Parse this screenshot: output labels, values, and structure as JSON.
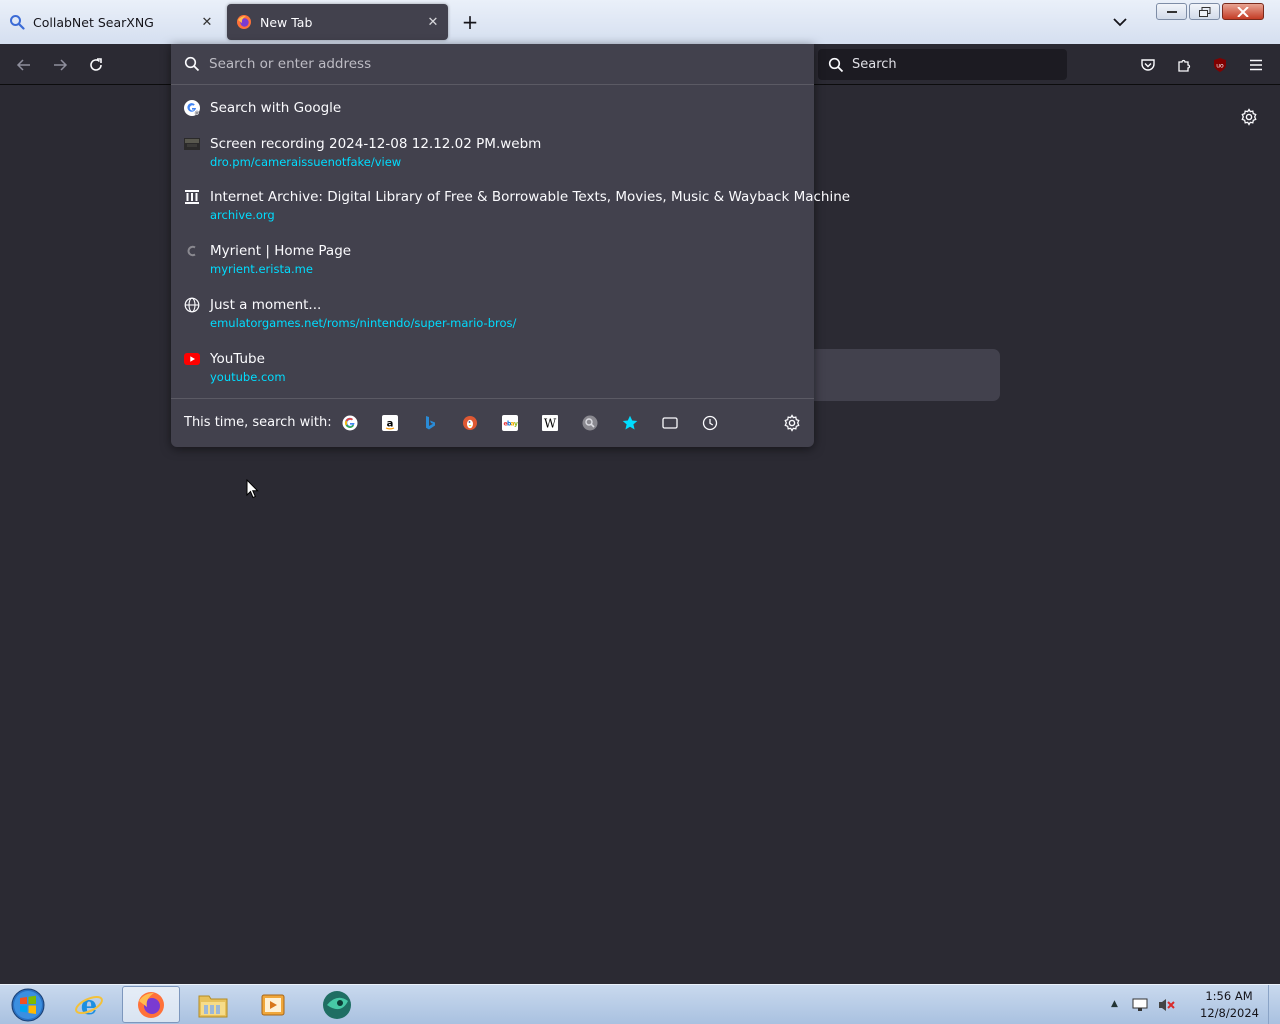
{
  "colors": {
    "accent_url": "#00ddff",
    "popup_bg": "#42414d",
    "page_bg": "#2b2a33"
  },
  "tabs": [
    {
      "title": "CollabNet SearXNG",
      "icon": "search-icon",
      "active": false
    },
    {
      "title": "New Tab",
      "icon": "firefox-icon",
      "active": true
    }
  ],
  "navbar": {
    "search_label": "Search"
  },
  "urlbar": {
    "placeholder": "Search or enter address",
    "value": ""
  },
  "results": [
    {
      "title": "Search with Google",
      "url": "",
      "icon": "google-search-icon"
    },
    {
      "title": "Screen recording 2024-12-08 12.12.02 PM.webm",
      "url": "dro.pm/cameraissuenotfake/view",
      "icon": "video-thumbnail-icon"
    },
    {
      "title": "Internet Archive: Digital Library of Free & Borrowable Texts, Movies, Music & Wayback Machine",
      "url": "archive.org",
      "icon": "archive-icon"
    },
    {
      "title": "Myrient | Home Page",
      "url": "myrient.erista.me",
      "icon": "myrient-icon"
    },
    {
      "title": "Just a moment...",
      "url": "emulatorgames.net/roms/nintendo/super-mario-bros/",
      "icon": "globe-icon"
    },
    {
      "title": "YouTube",
      "url": "youtube.com",
      "icon": "youtube-icon"
    }
  ],
  "oneoff": {
    "label": "This time, search with:",
    "engines": [
      "google-icon",
      "amazon-icon",
      "bing-icon",
      "duckduckgo-icon",
      "ebay-icon",
      "wikipedia-icon",
      "searxng-icon",
      "bookmarks-star-icon",
      "tabs-icon",
      "history-icon"
    ]
  },
  "taskbar": {
    "time": "1:56 AM",
    "date": "12/8/2024"
  }
}
